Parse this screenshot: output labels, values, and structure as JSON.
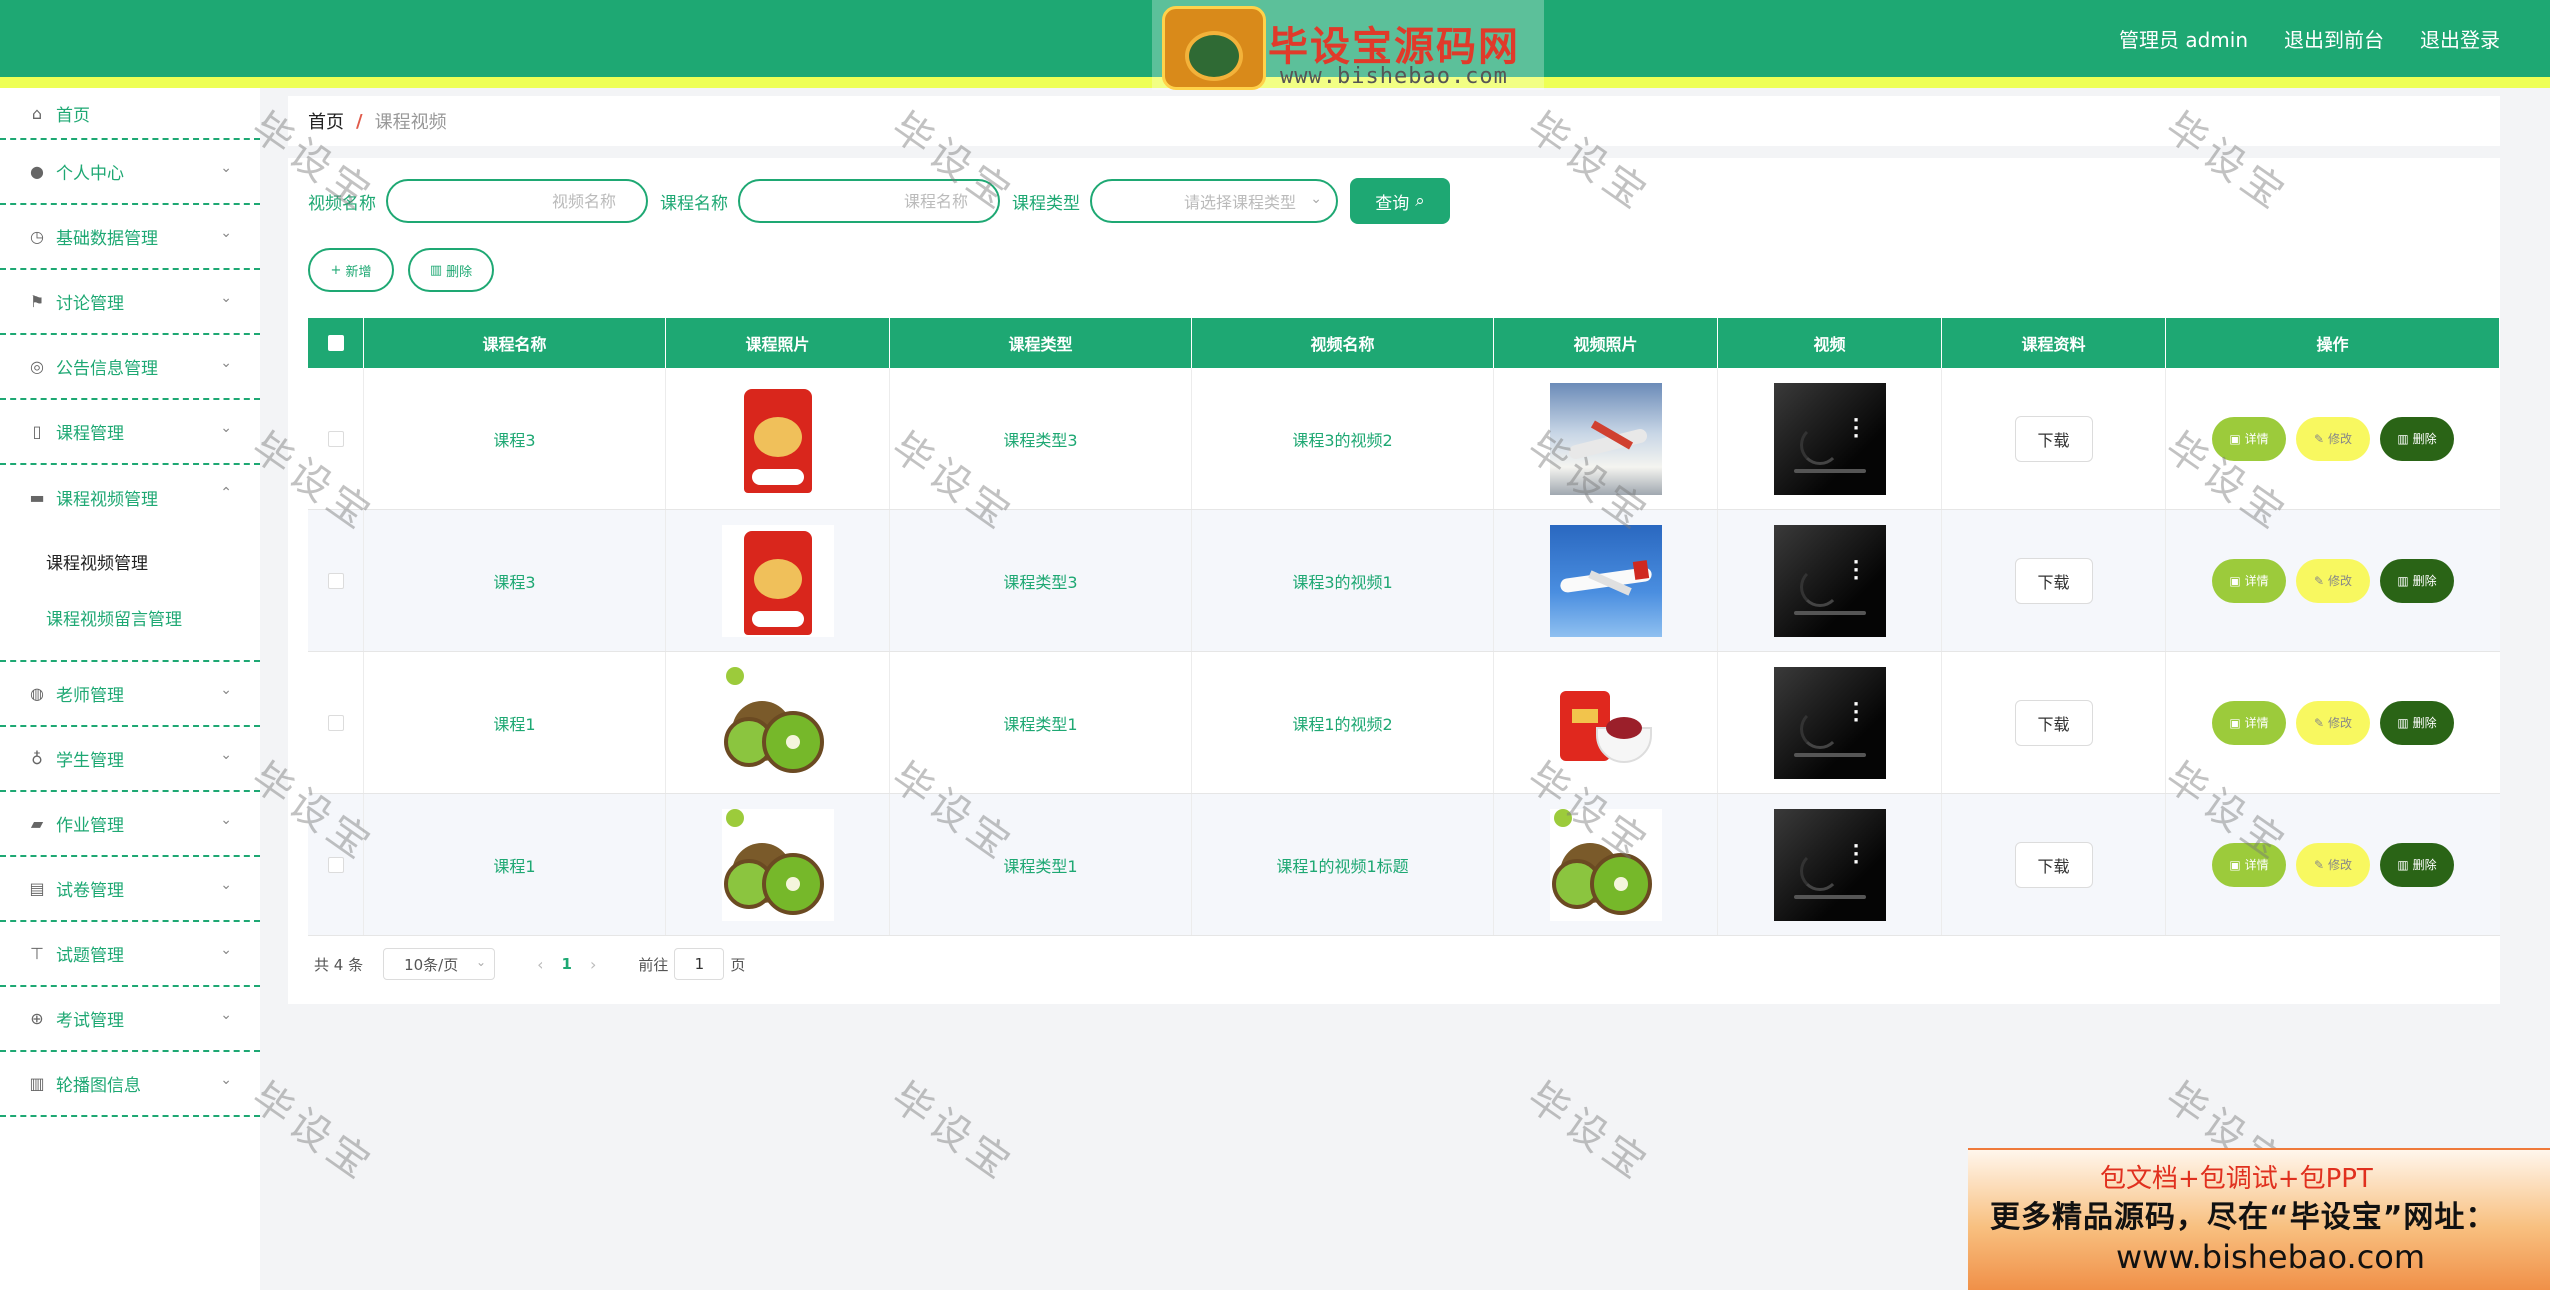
{
  "header": {
    "user_label": "管理员 admin",
    "to_front": "退出到前台",
    "logout": "退出登录"
  },
  "watermark": {
    "site_title": "毕设宝源码网",
    "site_url": "www.bishebao.com",
    "stamp_text": "毕设宝"
  },
  "sidebar": {
    "items": [
      {
        "label": "首页",
        "icon": "home-icon"
      },
      {
        "label": "个人中心",
        "icon": "user-icon"
      },
      {
        "label": "基础数据管理",
        "icon": "clock-icon"
      },
      {
        "label": "讨论管理",
        "icon": "flag-icon"
      },
      {
        "label": "公告信息管理",
        "icon": "compass-icon"
      },
      {
        "label": "课程管理",
        "icon": "phone-icon"
      },
      {
        "label": "课程视频管理",
        "icon": "briefcase-icon"
      },
      {
        "label": "老师管理",
        "icon": "palette-icon"
      },
      {
        "label": "学生管理",
        "icon": "microphone-icon"
      },
      {
        "label": "作业管理",
        "icon": "chat-icon"
      },
      {
        "label": "试卷管理",
        "icon": "clipboard-icon"
      },
      {
        "label": "试题管理",
        "icon": "stamp-icon"
      },
      {
        "label": "考试管理",
        "icon": "globe-icon"
      },
      {
        "label": "轮播图信息",
        "icon": "bar-chart-icon"
      }
    ],
    "submenu": [
      "课程视频管理",
      "课程视频留言管理"
    ]
  },
  "breadcrumb": {
    "home": "首页",
    "separator": "/",
    "current": "课程视频"
  },
  "search": {
    "video_name_label": "视频名称",
    "video_name_placeholder": "视频名称",
    "course_name_label": "课程名称",
    "course_name_placeholder": "课程名称",
    "course_type_label": "课程类型",
    "course_type_placeholder": "请选择课程类型",
    "search_button": "查询"
  },
  "actions": {
    "add": "新增",
    "delete": "删除"
  },
  "table": {
    "headers": [
      "课程名称",
      "课程照片",
      "课程类型",
      "视频名称",
      "视频照片",
      "视频",
      "课程资料",
      "操作"
    ],
    "rows": [
      {
        "course_name": "课程3",
        "course_type": "课程类型3",
        "video_name": "课程3的视频2",
        "course_img": "rice",
        "video_img": "plane1",
        "download": "下载"
      },
      {
        "course_name": "课程3",
        "course_type": "课程类型3",
        "video_name": "课程3的视频1",
        "course_img": "rice",
        "video_img": "plane2",
        "download": "下载"
      },
      {
        "course_name": "课程1",
        "course_type": "课程类型1",
        "video_name": "课程1的视频2",
        "course_img": "kiwi",
        "video_img": "snack",
        "download": "下载"
      },
      {
        "course_name": "课程1",
        "course_type": "课程类型1",
        "video_name": "课程1的视频1标题",
        "course_img": "kiwi",
        "video_img": "kiwi",
        "download": "下载"
      }
    ],
    "op_detail": "详情",
    "op_edit": "修改",
    "op_delete": "删除"
  },
  "pagination": {
    "total": "共 4 条",
    "page_size": "10条/页",
    "current_page": "1",
    "goto_prefix": "前往",
    "goto_value": "1",
    "goto_suffix": "页"
  },
  "ad": {
    "line1": "包文档+包调试+包PPT",
    "line2": "更多精品源码，尽在“毕设宝”网址：",
    "line3": "www.bishebao.com"
  },
  "colors": {
    "primary": "#1ea873",
    "stripe": "#eeff55",
    "detail": "#9ccb3b",
    "edit": "#f8f860",
    "delete": "#2a6416"
  }
}
